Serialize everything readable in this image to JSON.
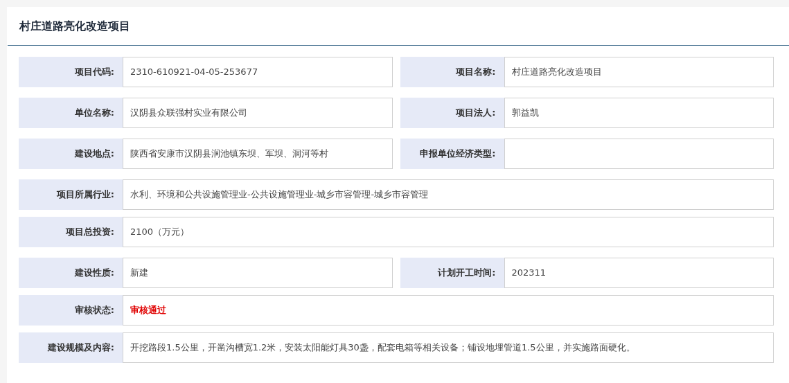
{
  "title": "村庄道路亮化改造项目",
  "rows": [
    {
      "fields": [
        {
          "label": "项目代码:",
          "value": "2310-610921-04-05-253677"
        },
        {
          "label": "项目名称:",
          "value": "村庄道路亮化改造项目"
        }
      ]
    },
    {
      "fields": [
        {
          "label": "单位名称:",
          "value": "汉阴县众联强村实业有限公司"
        },
        {
          "label": "项目法人:",
          "value": "郭益凯"
        }
      ]
    },
    {
      "fields": [
        {
          "label": "建设地点:",
          "value": "陕西省安康市汉阴县涧池镇东坝、军坝、洞河等村"
        },
        {
          "label": "申报单位经济类型:"
        }
      ]
    },
    {
      "fields": [
        {
          "label": "项目所属行业:",
          "value": "水利、环境和公共设施管理业-公共设施管理业-城乡市容管理-城乡市容管理"
        }
      ]
    },
    {
      "fields": [
        {
          "label": "项目总投资:",
          "value": "2100（万元）"
        }
      ]
    },
    {
      "fields": [
        {
          "label": "建设性质:",
          "value": "新建"
        },
        {
          "label": "计划开工时间:",
          "value": "202311"
        }
      ]
    },
    {
      "fields": [
        {
          "label": "审核状态:",
          "value": "审核通过",
          "kind": "status"
        }
      ]
    },
    {
      "fields": [
        {
          "label": "建设规模及内容:",
          "value": "开挖路段1.5公里，开凿沟槽宽1.2米，安装太阳能灯具30盏，配套电箱等相关设备；铺设地埋管道1.5公里，并实施路面硬化。"
        }
      ]
    }
  ]
}
